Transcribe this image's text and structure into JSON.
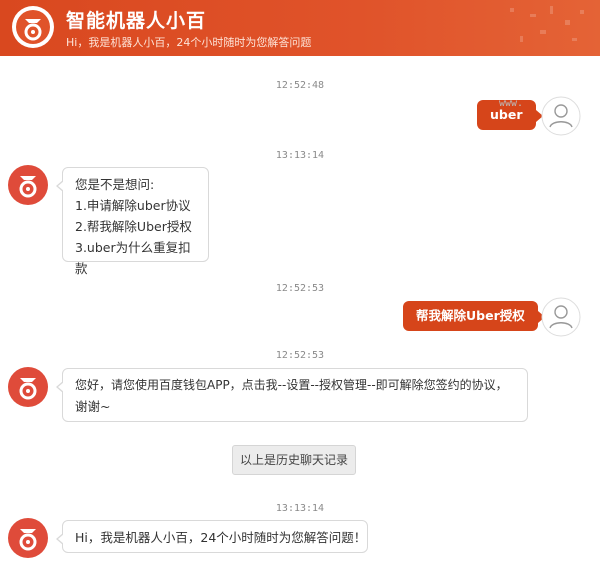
{
  "header": {
    "title": "智能机器人小百",
    "subtitle": "Hi，我是机器人小百，24个小时随时为您解答问题",
    "logo_icon": "baidu-wallet-logo-icon",
    "accent": "#d6451a"
  },
  "watermark": "www.",
  "messages": [
    {
      "time": "12:52:48",
      "from": "user",
      "text": "uber"
    },
    {
      "time": "13:13:14",
      "from": "bot",
      "lines": [
        "您是不是想问:",
        "1.申请解除uber协议",
        "2.帮我解除Uber授权",
        "3.uber为什么重复扣款"
      ]
    },
    {
      "time": "12:52:53",
      "from": "user",
      "text": "帮我解除Uber授权"
    },
    {
      "time": "12:52:53",
      "from": "bot",
      "lines": [
        "您好，请您使用百度钱包APP，点击我--设置--授权管理--即可解除您签约的协议，",
        "谢谢~"
      ]
    },
    {
      "time": "13:13:14",
      "from": "bot",
      "lines": [
        "Hi，我是机器人小百，24个小时随时为您解答问题！"
      ]
    }
  ],
  "history_label": "以上是历史聊天记录",
  "icons": {
    "bot_avatar": "robot-avatar-icon",
    "user_avatar": "user-avatar-icon"
  }
}
